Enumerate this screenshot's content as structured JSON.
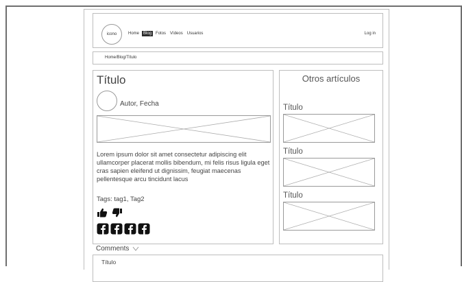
{
  "navbar": {
    "logo_text": "icono",
    "links": [
      {
        "label": "Home",
        "active": false
      },
      {
        "label": "Blog",
        "active": true
      },
      {
        "label": "Fotos",
        "active": false
      },
      {
        "label": "Vídeos",
        "active": false
      },
      {
        "label": "Usuarios",
        "active": false
      }
    ],
    "login_label": "Log in"
  },
  "breadcrumb": "Home/Blog/Título",
  "article": {
    "title": "Título",
    "author_meta": "Autor, Fecha",
    "body": "Lorem ipsum dolor sit amet consectetur adipiscing elit ullamcorper placerat mollis bibendum, mi felis risus ligula eget cras sapien eleifend ut dignissim, feugiat maecenas pellentesque arcu tincidunt lacus",
    "tags": "Tags: tag1, Tag2",
    "reactions": [
      "thumbs-up-icon",
      "thumbs-down-icon"
    ],
    "share_icons": [
      "facebook-icon",
      "facebook-icon",
      "facebook-icon",
      "facebook-icon"
    ]
  },
  "sidebar": {
    "title": "Otros artículos",
    "items": [
      {
        "title": "Título"
      },
      {
        "title": "Título"
      },
      {
        "title": "Título"
      }
    ]
  },
  "comments": {
    "toggle_label": "Comments",
    "first_title": "Título"
  },
  "colors": {
    "border": "#bdbdbd",
    "active_nav_bg": "#2b2b2b",
    "frame": "#6e6e6e"
  }
}
